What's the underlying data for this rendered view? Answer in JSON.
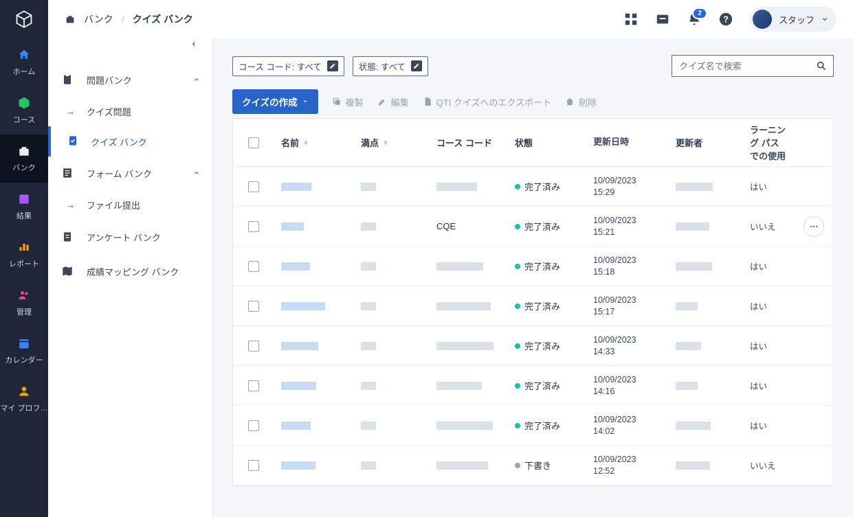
{
  "header": {
    "crumb_root": "バンク",
    "crumb_current": "クイズ バンク",
    "notification_count": "2",
    "user_label": "スタッフ"
  },
  "nav_rail": {
    "items": [
      {
        "label": "ホーム"
      },
      {
        "label": "コース"
      },
      {
        "label": "バンク"
      },
      {
        "label": "結果"
      },
      {
        "label": "レポート"
      },
      {
        "label": "管理"
      },
      {
        "label": "カレンダー"
      },
      {
        "label": "マイ プロフ…"
      }
    ]
  },
  "sidebar": {
    "groups": {
      "question_bank": "問題バンク",
      "quiz_questions": "クイズ問題",
      "quiz_bank": "クイズ バンク",
      "form_bank": "フォーム バンク",
      "file_submission": "ファイル提出",
      "survey_bank": "アンケート バンク",
      "mapping_bank": "成績マッピング バンク"
    }
  },
  "filters": {
    "course_code": "コース コード: すべて",
    "state": "状態: すべて",
    "search_placeholder": "クイズ名で検索"
  },
  "toolbar": {
    "create": "クイズの作成",
    "duplicate": "複製",
    "edit": "編集",
    "export": "QTI クイズへのエクスポート",
    "delete": "削除"
  },
  "table": {
    "headers": {
      "name": "名前",
      "score": "満点",
      "code": "コース コード",
      "state": "状態",
      "updated": "更新日時",
      "updater": "更新者",
      "lp": "ラーニング パスでの使用"
    },
    "rows": [
      {
        "code": "",
        "state": "完了済み",
        "dot": "g",
        "date": "10/09/2023",
        "time": "15:29",
        "lp": "はい"
      },
      {
        "code": "CQE",
        "state": "完了済み",
        "dot": "g",
        "date": "10/09/2023",
        "time": "15:21",
        "lp": "いいえ",
        "menu": true
      },
      {
        "code": "",
        "state": "完了済み",
        "dot": "g",
        "date": "10/09/2023",
        "time": "15:18",
        "lp": "はい"
      },
      {
        "code": "",
        "state": "完了済み",
        "dot": "g",
        "date": "10/09/2023",
        "time": "15:17",
        "lp": "はい"
      },
      {
        "code": "",
        "state": "完了済み",
        "dot": "g",
        "date": "10/09/2023",
        "time": "14:33",
        "lp": "はい"
      },
      {
        "code": "",
        "state": "完了済み",
        "dot": "g",
        "date": "10/09/2023",
        "time": "14:16",
        "lp": "はい"
      },
      {
        "code": "",
        "state": "完了済み",
        "dot": "g",
        "date": "10/09/2023",
        "time": "14:02",
        "lp": "はい"
      },
      {
        "code": "",
        "state": "下書き",
        "dot": "x",
        "date": "10/09/2023",
        "time": "12:52",
        "lp": "いいえ"
      }
    ]
  }
}
